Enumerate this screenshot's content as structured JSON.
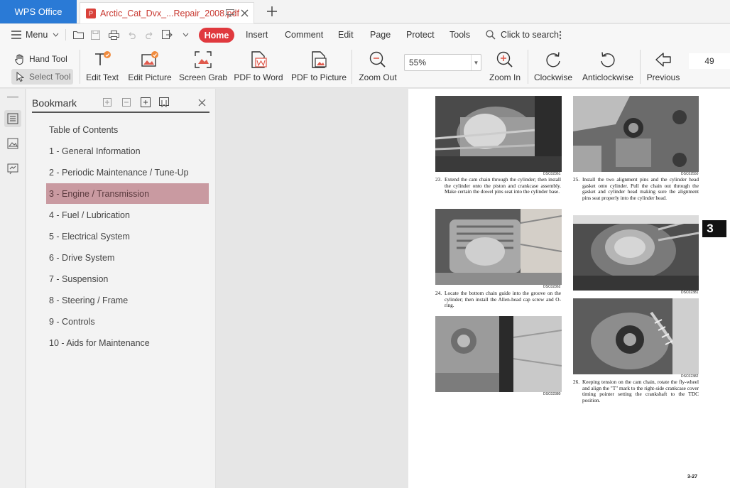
{
  "app": {
    "name": "WPS Office"
  },
  "tab": {
    "title": "Arctic_Cat_Dvx_...Repair_2008.pdf"
  },
  "menubar": {
    "menu_label": "Menu",
    "items": [
      "Home",
      "Insert",
      "Comment",
      "Edit",
      "Page",
      "Protect",
      "Tools"
    ],
    "search_label": "Click to search"
  },
  "ribbon": {
    "hand_tool": "Hand Tool",
    "select_tool": "Select Tool",
    "edit_text": "Edit Text",
    "edit_picture": "Edit Picture",
    "screen_grab": "Screen Grab",
    "pdf_to_word": "PDF to Word",
    "pdf_to_picture": "PDF to Picture",
    "zoom_out": "Zoom Out",
    "zoom_value": "55%",
    "zoom_in": "Zoom In",
    "clockwise": "Clockwise",
    "anticlockwise": "Anticlockwise",
    "previous": "Previous",
    "page_number": "49"
  },
  "bookmark": {
    "title": "Bookmark",
    "selected_index": 3,
    "items": [
      "Table of Contents",
      "1 - General Information",
      "2 - Periodic Maintenance / Tune-Up",
      "3 - Engine / Transmission",
      "4 - Fuel / Lubrication",
      "5 - Electrical System",
      "6 - Drive System",
      "7 - Suspension",
      "8 - Steering / Frame",
      "9 - Controls",
      "10 - Aids for Maintenance"
    ]
  },
  "page": {
    "section_tab": "3",
    "page_number": "3-27",
    "photo_ids": [
      "DSC02361",
      "DSC02550",
      "DSC02362",
      "DSC02381",
      "DSC02380",
      "DSC02382"
    ],
    "steps": [
      {
        "num": "23.",
        "text": "Extend the cam chain through the cylinder; then install the cylinder onto the piston and crankcase assembly. Make certain the dowel pins seat into the cylinder base."
      },
      {
        "num": "25.",
        "text": "Install the two alignment pins and the cylinder head gasket onto cylinder. Pull the chain out through the gasket and cylinder head making sure the alignment pins seat properly into the cylinder head."
      },
      {
        "num": "24.",
        "text": "Locate the bottom chain guide into the groove on the cylinder; then install the Allen-head cap screw and O-ring."
      },
      {
        "num": "26.",
        "text": "Keeping tension on the cam chain, rotate the fly-wheel and align the \"T\" mark to the right-side crankcase cover timing pointer setting the crankshaft to the TDC position."
      }
    ]
  }
}
